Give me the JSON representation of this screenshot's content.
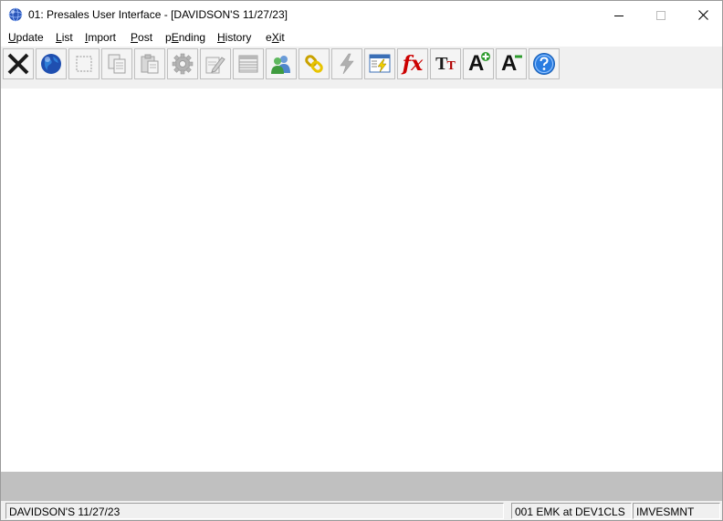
{
  "window": {
    "title": "01: Presales User Interface - [DAVIDSON'S 11/27/23]",
    "controls": [
      "minimize",
      "maximize",
      "close"
    ]
  },
  "menu": [
    {
      "pre": "",
      "acc": "U",
      "post": "pdate"
    },
    {
      "pre": "",
      "acc": "L",
      "post": "ist"
    },
    {
      "pre": "",
      "acc": "I",
      "post": "mport"
    },
    {
      "pre": "",
      "acc": "P",
      "post": "ost"
    },
    {
      "pre": "p",
      "acc": "E",
      "post": "nding"
    },
    {
      "pre": "",
      "acc": "H",
      "post": "istory"
    },
    {
      "pre": "e",
      "acc": "X",
      "post": "it"
    }
  ],
  "toolbar": [
    {
      "icon": "close-x-icon",
      "enabled": true
    },
    {
      "icon": "globe-icon",
      "enabled": true
    },
    {
      "icon": "select-box-icon",
      "enabled": false
    },
    {
      "icon": "copy-icon",
      "enabled": false
    },
    {
      "icon": "paste-icon",
      "enabled": false
    },
    {
      "icon": "gear-icon",
      "enabled": false
    },
    {
      "icon": "edit-pencil-icon",
      "enabled": false
    },
    {
      "icon": "table-icon",
      "enabled": false
    },
    {
      "icon": "users-icon",
      "enabled": true
    },
    {
      "icon": "link-chain-icon",
      "enabled": true
    },
    {
      "icon": "lightning-icon",
      "enabled": false
    },
    {
      "icon": "window-lightning-icon",
      "enabled": true
    },
    {
      "icon": "fx-icon",
      "enabled": true
    },
    {
      "icon": "font-tt-icon",
      "enabled": true
    },
    {
      "icon": "font-increase-icon",
      "enabled": true
    },
    {
      "icon": "font-decrease-icon",
      "enabled": true
    },
    {
      "icon": "help-icon",
      "enabled": true
    }
  ],
  "icon_text": {
    "fx": "fx",
    "tt_big": "T",
    "tt_small": "T",
    "a_inc": "A",
    "a_dec": "A"
  },
  "colors": {
    "toolbar_bg": "#f0f0f0",
    "band": "#c0c0c0",
    "fx_red": "#cc0000",
    "help_blue": "#2a7de1",
    "link_gold": "#d4b000",
    "users_green": "#3f9b3f"
  },
  "status": {
    "left": "DAVIDSON'S 11/27/23",
    "middle": "001 EMK at DEV1CLS",
    "right": "IMVESMNT"
  }
}
